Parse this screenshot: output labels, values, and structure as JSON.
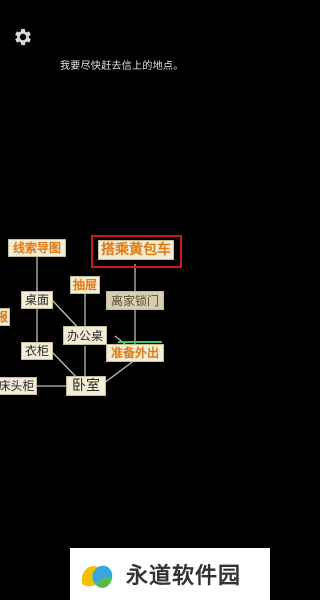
{
  "header": {
    "settings_icon": "gear-icon",
    "hint": "我要尽快赶去信上的地点。"
  },
  "nodes": {
    "clue_map": "线索导图",
    "take_bus": "搭乘黄包车",
    "drawer": "抽屉",
    "desk_surface": "桌面",
    "leave_lock": "离家锁门",
    "partial_left": "报",
    "office_desk": "办公桌",
    "wardrobe": "衣柜",
    "prepare_out": "准备外出",
    "bedside": "床头柜",
    "bedroom": "卧室"
  },
  "colors": {
    "node_bg": "#f3ecd6",
    "accent_orange": "#e07a12",
    "highlight_red": "#d01818",
    "progress_green": "#3fc85a"
  },
  "footer": {
    "brand": "永道软件园"
  }
}
